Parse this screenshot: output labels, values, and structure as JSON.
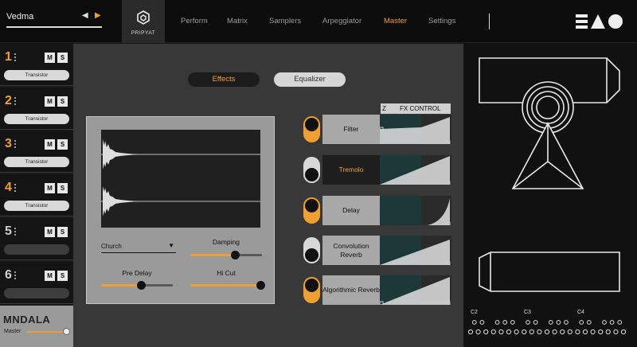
{
  "preset": {
    "name": "Vedma",
    "prev_icon": "◀",
    "next_icon": "▶"
  },
  "brand": {
    "product": "PRIPYAT",
    "company": "MNDALA"
  },
  "nav": {
    "items": [
      "Perform",
      "Matrix",
      "Samplers",
      "Arpeggiator",
      "Master",
      "Settings"
    ],
    "active": "Master"
  },
  "channels": [
    {
      "number": "1",
      "mute": "M",
      "solo": "S",
      "effect": "Transistor"
    },
    {
      "number": "2",
      "mute": "M",
      "solo": "S",
      "effect": "Transistor"
    },
    {
      "number": "3",
      "mute": "M",
      "solo": "S",
      "effect": "Transistor"
    },
    {
      "number": "4",
      "mute": "M",
      "solo": "S",
      "effect": "Transistor"
    },
    {
      "number": "5",
      "mute": "M",
      "solo": "S",
      "effect": ""
    },
    {
      "number": "6",
      "mute": "M",
      "solo": "S",
      "effect": ""
    }
  ],
  "master": {
    "label": "Master",
    "level": 0.95
  },
  "tabs": {
    "effects": "Effects",
    "equalizer": "Equalizer",
    "active": "Effects"
  },
  "reverb": {
    "type": "Church",
    "controls": [
      {
        "label": "Damping",
        "value": 0.62
      },
      {
        "label": "Pre Delay",
        "value": 0.55
      },
      {
        "label": "Hi Cut",
        "value": 0.98
      }
    ]
  },
  "fx_control": {
    "header_z": "Z",
    "header_title": "FX CONTROL",
    "effects": [
      {
        "name": "Filter",
        "enabled": true,
        "selected": false
      },
      {
        "name": "Tremolo",
        "enabled": false,
        "selected": true
      },
      {
        "name": "Delay",
        "enabled": true,
        "selected": false
      },
      {
        "name": "Convolution Reverb",
        "enabled": false,
        "selected": false
      },
      {
        "name": "Algorithmic Reverb",
        "enabled": true,
        "selected": false
      }
    ]
  },
  "keyboard": {
    "octaves": [
      "C2",
      "C3",
      "C4"
    ]
  },
  "colors": {
    "accent": "#f0a030",
    "panel": "#9a9a9a",
    "background": "#141414"
  }
}
